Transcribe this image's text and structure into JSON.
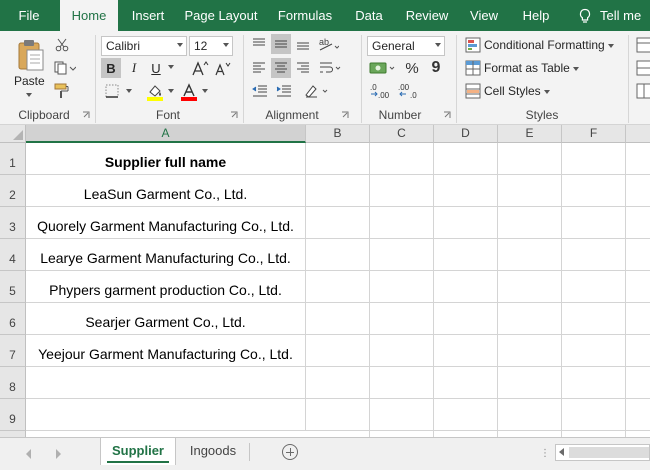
{
  "ribbon_tabs": [
    "File",
    "Home",
    "Insert",
    "Page Layout",
    "Formulas",
    "Data",
    "Review",
    "View",
    "Help",
    "Tell me"
  ],
  "clipboard": {
    "paste_label": "Paste",
    "group_label": "Clipboard"
  },
  "font": {
    "name": "Calibri",
    "size": "12",
    "group_label": "Font",
    "bold": "B",
    "italic": "I",
    "underline": "U",
    "fill_color": "#FFFF00",
    "font_color": "#FF0000"
  },
  "alignment": {
    "group_label": "Alignment"
  },
  "number": {
    "format": "General",
    "group_label": "Number",
    "percent": "%",
    "comma": "9"
  },
  "styles": {
    "conditional_formatting": "Conditional Formatting",
    "format_as_table": "Format as Table",
    "cell_styles": "Cell Styles",
    "group_label": "Styles"
  },
  "sheet": {
    "columns": [
      "A",
      "B",
      "C",
      "D",
      "E",
      "F"
    ],
    "rows": [
      "1",
      "2",
      "3",
      "4",
      "5",
      "6",
      "7",
      "8",
      "9"
    ],
    "cells": [
      "Supplier full name",
      "LeaSun Garment Co., Ltd.",
      "Quorely Garment Manufacturing Co., Ltd.",
      "Learye Garment Manufacturing Co., Ltd.",
      "Phypers garment production Co., Ltd.",
      "Searjer Garment Co., Ltd.",
      "Yeejour Garment Manufacturing Co., Ltd.",
      "",
      ""
    ]
  },
  "sheet_tabs": [
    "Supplier",
    "Ingoods"
  ],
  "colors": {
    "accent": "#217346"
  }
}
